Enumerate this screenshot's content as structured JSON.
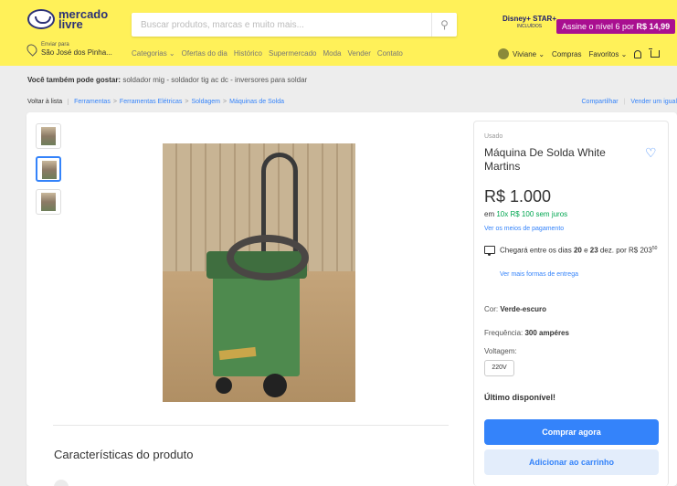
{
  "header": {
    "logo_text_1": "mercado",
    "logo_text_2": "livre",
    "search_placeholder": "Buscar produtos, marcas e muito mais...",
    "disney_text": "Disney+ STAR+",
    "disney_sub": "INCLUÍDOS",
    "promo_text": "Assine o nível 6 por ",
    "promo_price": "R$ 14,99",
    "location_label": "Enviar para",
    "location_value": "São José dos Pinha...",
    "nav": [
      "Categorias ⌄",
      "Ofertas do dia",
      "Histórico",
      "Supermercado",
      "Moda",
      "Vender",
      "Contato"
    ],
    "user": "Viviane ⌄",
    "purchases": "Compras",
    "favorites": "Favoritos ⌄"
  },
  "suggestion": {
    "label": "Você também pode gostar:",
    "text": " soldador mig - soldador tig ac dc - inversores para soldar"
  },
  "breadcrumb": {
    "back": "Voltar à lista",
    "items": [
      "Ferramentas",
      "Ferramentas Elétricas",
      "Soldagem",
      "Máquinas de Solda"
    ],
    "share": "Compartilhar",
    "sell": "Vender um igual"
  },
  "product": {
    "condition": "Usado",
    "title": "Máquina De Solda White Martins",
    "price": "R$ 1.000",
    "installments_prefix": "em ",
    "installments": "10x R$ 100 sem juros",
    "payment_link": "Ver os meios de pagamento",
    "shipping_prefix": "Chegará entre os dias ",
    "shipping_day1": "20",
    "shipping_mid": " e ",
    "shipping_day2": "23",
    "shipping_suffix": " dez. por R$ 203",
    "shipping_cents": "50",
    "shipping_link": "Ver mais formas de entrega",
    "color_label": "Cor: ",
    "color_value": "Verde-escuro",
    "freq_label": "Frequência: ",
    "freq_value": "300 ampéres",
    "voltage_label": "Voltagem:",
    "voltage_value": "220V",
    "stock": "Último disponível!",
    "buy_now": "Comprar agora",
    "add_to_cart": "Adicionar ao carrinho"
  },
  "features_title": "Características do produto",
  "colors": {
    "header_bg": "#fff159",
    "accent": "#3483fa",
    "green": "#00a650",
    "promo_bg": "#a90f90"
  }
}
